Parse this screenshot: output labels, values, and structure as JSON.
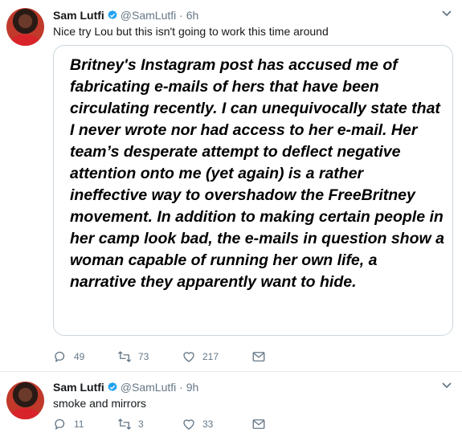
{
  "tweets": [
    {
      "author_name": "Sam Lutfi",
      "handle": "@SamLutfi",
      "separator": "·",
      "time": "6h",
      "text": "Nice try Lou but this isn't going to work this time around",
      "card_text": "Britney's Instagram post has accused me of fabricating e-mails of hers that have been circulating recently. I can unequivocally state that I never wrote nor had access to her e-mail. Her team’s desperate attempt to deflect negative attention onto me (yet again) is a rather ineffective way to overshadow the FreeBritney movement. In addition to making certain people in her camp look bad, the e-mails in question show a woman capable of running her own life, a narrative they apparently want to hide.",
      "replies": "49",
      "retweets": "73",
      "likes": "217"
    },
    {
      "author_name": "Sam Lutfi",
      "handle": "@SamLutfi",
      "separator": "·",
      "time": "9h",
      "text": "smoke and mirrors",
      "replies": "11",
      "retweets": "3",
      "likes": "33"
    }
  ],
  "colors": {
    "verified": "#1da1f2",
    "secondary_text": "#657786",
    "border": "#ccd6dd"
  },
  "icons": [
    "verified-badge-icon",
    "chevron-down-icon",
    "reply-icon",
    "retweet-icon",
    "like-icon",
    "direct-message-icon"
  ]
}
